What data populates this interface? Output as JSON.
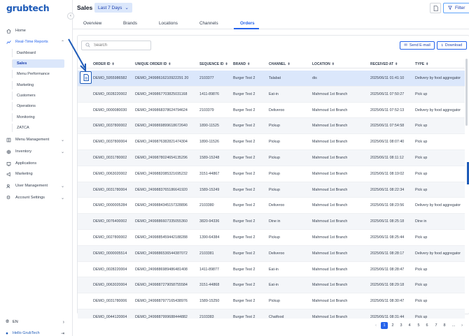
{
  "brand": {
    "logo": "grubtech"
  },
  "sidebar": {
    "items": [
      {
        "label": "Home",
        "icon": "home-icon"
      },
      {
        "label": "Real-Time Reports",
        "icon": "chart-icon"
      },
      {
        "label": "Menu Management",
        "icon": "menu-icon"
      },
      {
        "label": "Inventory",
        "icon": "inventory-icon"
      },
      {
        "label": "Applications",
        "icon": "apps-icon"
      },
      {
        "label": "Marketing",
        "icon": "megaphone-icon"
      },
      {
        "label": "User Management",
        "icon": "users-icon"
      },
      {
        "label": "Account Settings",
        "icon": "gear-icon"
      }
    ],
    "sub_items": [
      "Dashboard",
      "Sales",
      "Menu Performance",
      "Marketing",
      "Customers",
      "Operations",
      "Monitoring",
      "ZATCA"
    ],
    "language": "EN",
    "user": "Hello GrubTech"
  },
  "header": {
    "title": "Sales",
    "date_range": "Last 7 Days",
    "filter_label": "Filter"
  },
  "tabs": [
    "Overview",
    "Brands",
    "Locations",
    "Channels",
    "Orders"
  ],
  "toolbar": {
    "search_placeholder": "Search",
    "send_email": "Send E-mail",
    "download": "Download"
  },
  "table": {
    "headers": [
      "ORDER ID",
      "UNIQUE ORDER ID",
      "SEQUENCE ID",
      "BRAND",
      "CHANNEL",
      "LOCATION",
      "RECEIVED AT",
      "TYPE"
    ],
    "rows": [
      [
        "DEMO_5955986582",
        "DEMO_24998616210922291 20",
        "2103377",
        "Burger Test 2",
        "Talabat",
        "dis",
        "2025/06/11 01:41:10",
        "Delivery by food aggregator"
      ],
      [
        "DEMO_0028220002",
        "DEMO_2499867703825031168",
        "1411-89876",
        "Burger Test 2",
        "Eat-in",
        "Mahmoud 1st Branch",
        "2025/06/11 07:50:27",
        "Pick up"
      ],
      [
        "DEMO_0000080030",
        "DEMO_2499868378624794624",
        "2103379",
        "Burger Test 2",
        "Deliveroo",
        "Mahmoud 1st Branch",
        "2025/06/11 07:52:13",
        "Delivery by food aggregator"
      ],
      [
        "DEMO_0037800002",
        "DEMO_2499869899618672640",
        "1890-11525",
        "Burger Test 2",
        "Pickup",
        "Mahmoud 1st Branch",
        "2025/06/11 07:54:58",
        "Pick up"
      ],
      [
        "DEMO_0037800004",
        "DEMO_2499876382821474304",
        "1890-11526",
        "Burger Test 2",
        "Pickup",
        "Mahmoud 1st Branch",
        "2025/06/11 08:07:40",
        "Pick up"
      ],
      [
        "DEMO_0031780002",
        "DEMO_2499878024654135296",
        "1589-15248",
        "Burger Test 2",
        "Pickup",
        "Mahmoud 1st Branch",
        "2025/06/11 08:11:12",
        "Pick up"
      ],
      [
        "DEMO_0063020002",
        "DEMO_2499882085321695232",
        "3151-44867",
        "Burger Test 2",
        "Pickup",
        "Mahmoud 1st Branch",
        "2025/06/11 08:19:02",
        "Pick up"
      ],
      [
        "DEMO_0031780004",
        "DEMO_2499883765186641920",
        "1589-15249",
        "Burger Test 2",
        "Pickup",
        "Mahmoud 1st Branch",
        "2025/06/11 08:22:34",
        "Pick up"
      ],
      [
        "DEMO_0000005284",
        "DEMO_2499884345157328896",
        "2103380",
        "Burger Test 2",
        "Deliveroo",
        "Mahmoud 1st Branch",
        "2025/06/11 08:23:56",
        "Delivery by food aggregator"
      ],
      [
        "DEMO_0076400002",
        "DEMO_2499886607335055360",
        "3820-94336",
        "Burger Test 2",
        "Dine in",
        "Mahmoud 1st Branch",
        "2025/06/11 08:25:18",
        "Dine in"
      ],
      [
        "DEMO_0027800002",
        "DEMO_2499885459442188288",
        "1390-64384",
        "Burger Test 2",
        "Pickup",
        "Mahmoud 1st Branch",
        "2025/06/11 08:25:44",
        "Pick up"
      ],
      [
        "DEMO_0000005514",
        "DEMO_2499886536544387072",
        "2103381",
        "Burger Test 2",
        "Deliveroo",
        "Mahmoud 1st Branch",
        "2025/06/11 08:28:17",
        "Delivery by food aggregator"
      ],
      [
        "DEMO_0028220004",
        "DEMO_2499886989486481408",
        "1411-89877",
        "Burger Test 2",
        "Eat-in",
        "Mahmoud 1st Branch",
        "2025/06/11 08:28:47",
        "Pick up"
      ],
      [
        "DEMO_0063020004",
        "DEMO_2499887279058755584",
        "3151-44868",
        "Burger Test 2",
        "Eat-in",
        "Mahmoud 1st Branch",
        "2025/06/11 08:29:18",
        "Pick up"
      ],
      [
        "DEMO_0031780006",
        "DEMO_2499887977165438976",
        "1589-15250",
        "Burger Test 2",
        "Pickup",
        "Mahmoud 1st Branch",
        "2025/06/11 08:30:47",
        "Pick up"
      ],
      [
        "DEMO_0044120004",
        "DEMO_2499887999688444882",
        "2103383",
        "Burger Test 2",
        "Chatfood",
        "Mahmoud 1st Branch",
        "2025/06/11 08:31:44",
        "Pick up"
      ]
    ]
  },
  "pagination": {
    "pages": [
      "1",
      "2",
      "3",
      "4",
      "5",
      "6",
      "7",
      "8",
      "..."
    ],
    "prev": "‹",
    "next": "›"
  },
  "colors": {
    "accent": "#2563eb",
    "brand": "#1e5bb8",
    "active_bg": "#dbe7fb"
  }
}
